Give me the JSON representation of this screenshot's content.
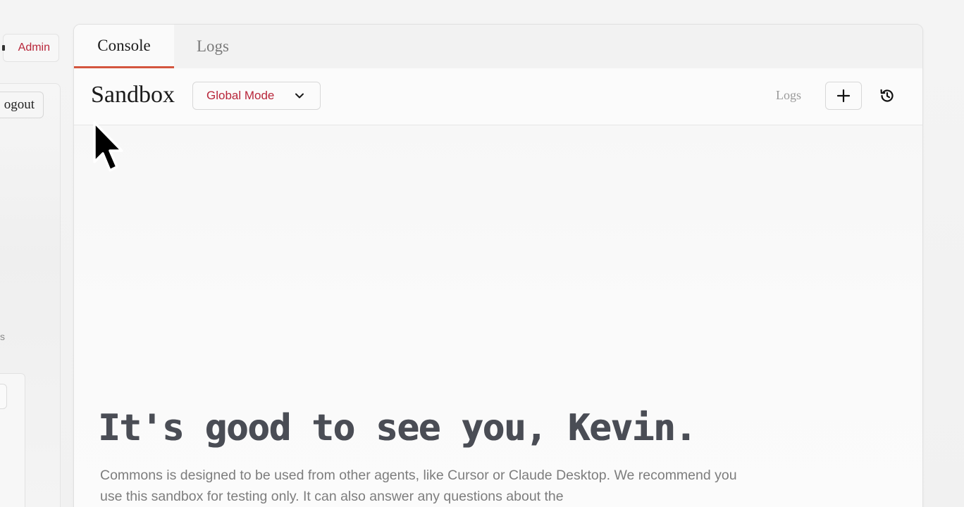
{
  "sidebar": {
    "admin_label": "Admin",
    "logout_label": "ogout",
    "fragment_text": "s"
  },
  "tabs": [
    {
      "label": "Console",
      "active": true
    },
    {
      "label": "Logs",
      "active": false
    }
  ],
  "header": {
    "title": "Sandbox",
    "mode_select": {
      "value": "Global Mode"
    },
    "logs_link_label": "Logs",
    "add_icon": "plus-icon",
    "history_icon": "history-icon"
  },
  "content": {
    "greeting": "It's good to see you, Kevin.",
    "description": "Commons is designed to be used from other agents, like Cursor or Claude Desktop. We recommend you use this sandbox for testing only. It can also answer any questions about the"
  },
  "colors": {
    "accent": "#d4563f",
    "brand_red": "#b8263a",
    "greeting_text": "#4a4d55"
  }
}
